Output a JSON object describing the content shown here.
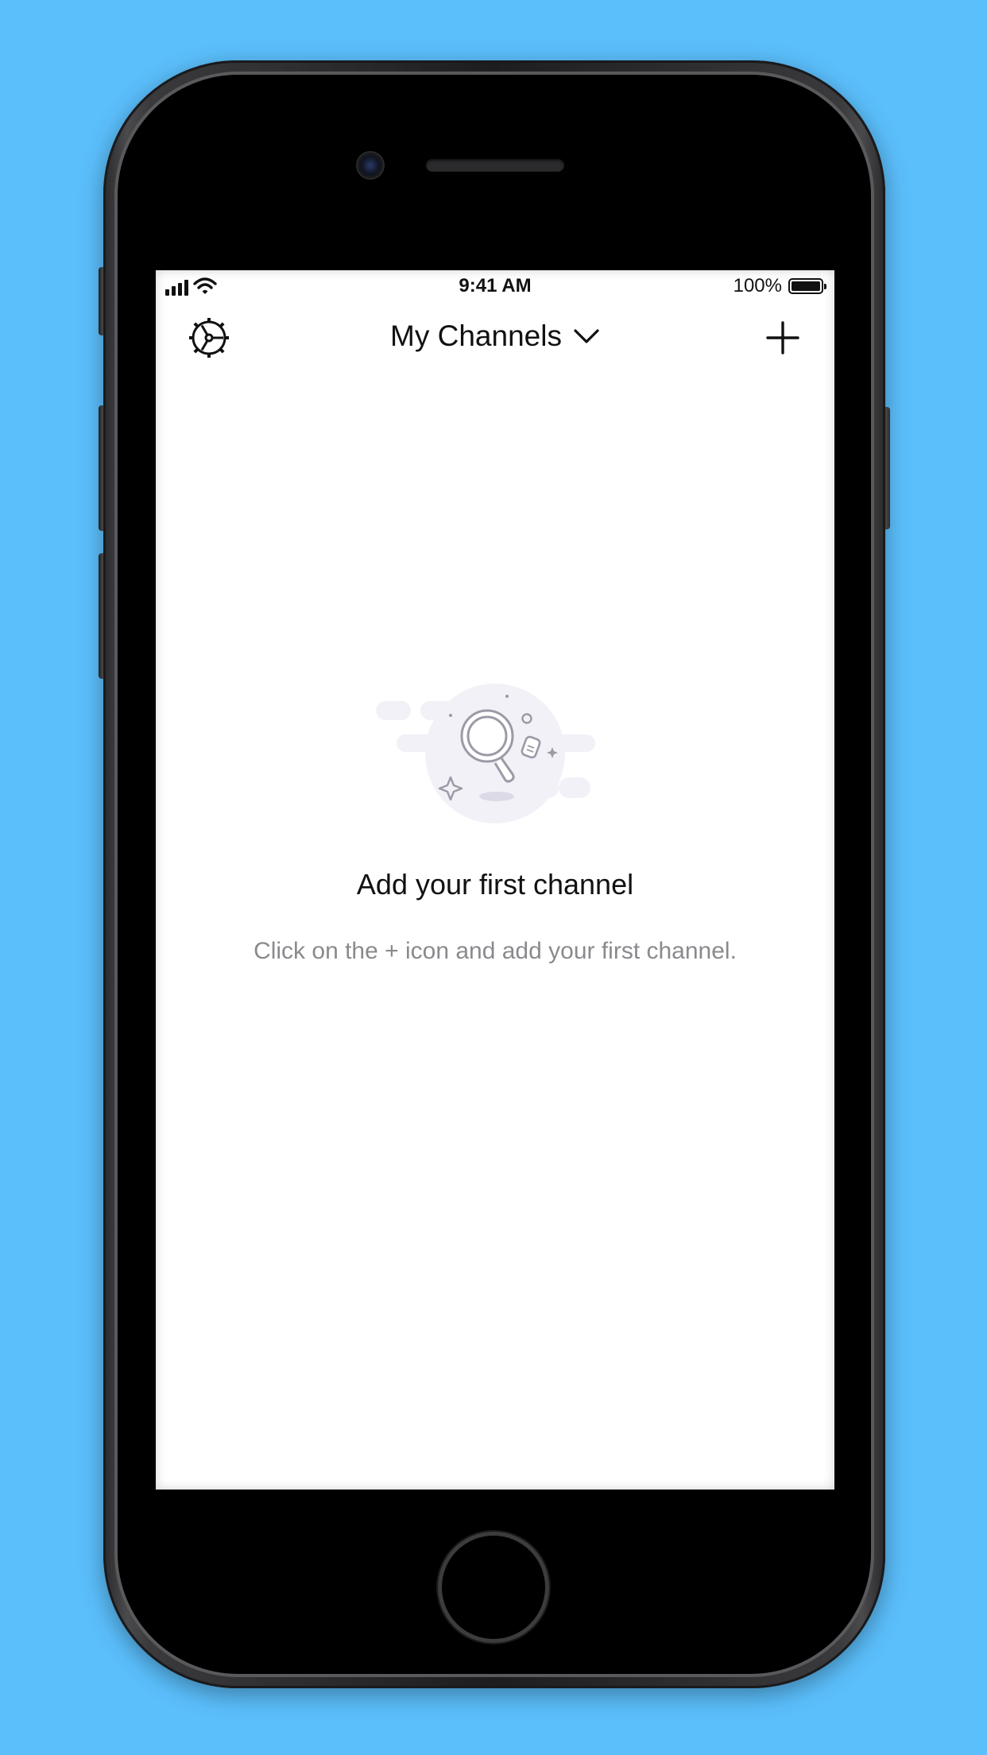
{
  "status_bar": {
    "time": "9:41 AM",
    "battery_percent": "100%",
    "icons": [
      "signal-icon",
      "wifi-icon",
      "battery-icon"
    ]
  },
  "nav": {
    "title": "My Channels",
    "left_icon": "settings-icon",
    "title_icon": "chevron-down-icon",
    "right_icon": "plus-icon"
  },
  "empty_state": {
    "title": "Add your first channel",
    "subtitle": "Click on the + icon and add your first channel.",
    "illustration": "magnifier-illustration"
  },
  "colors": {
    "background": "#5bbffc",
    "screen": "#ffffff",
    "text_primary": "#111111",
    "text_secondary": "#8a8a8e",
    "illustration_fill": "#f2f1f7",
    "illustration_stroke": "#9c9aa6"
  }
}
